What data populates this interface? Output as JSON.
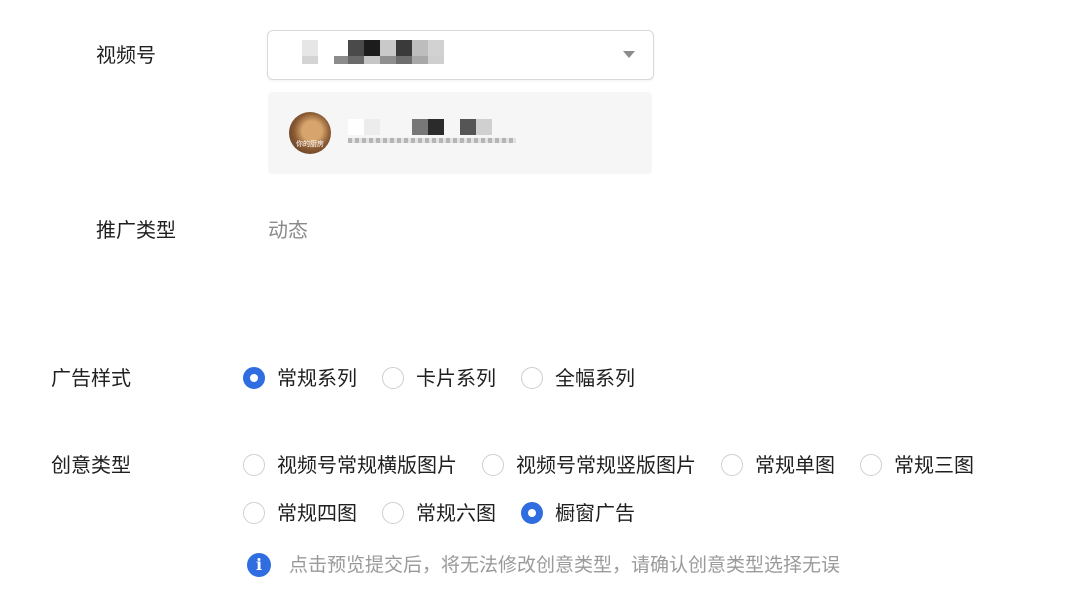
{
  "channel": {
    "label": "视频号",
    "select_icon": "chevron-down-icon",
    "account_avatar_caption": "你的厨房"
  },
  "promotion_type": {
    "label": "推广类型",
    "value": "动态"
  },
  "ad_style": {
    "label": "广告样式",
    "options": [
      {
        "label": "常规系列",
        "checked": true
      },
      {
        "label": "卡片系列",
        "checked": false
      },
      {
        "label": "全幅系列",
        "checked": false
      }
    ]
  },
  "creative_type": {
    "label": "创意类型",
    "options": [
      {
        "label": "视频号常规横版图片",
        "checked": false
      },
      {
        "label": "视频号常规竖版图片",
        "checked": false
      },
      {
        "label": "常规单图",
        "checked": false
      },
      {
        "label": "常规三图",
        "checked": false
      },
      {
        "label": "常规四图",
        "checked": false
      },
      {
        "label": "常规六图",
        "checked": false
      },
      {
        "label": "橱窗广告",
        "checked": true
      }
    ]
  },
  "notice": {
    "icon": "info-icon",
    "text": "点击预览提交后，将无法修改创意类型，请确认创意类型选择无误"
  },
  "colors": {
    "accent": "#2f6de1",
    "text": "#1f1f1f",
    "muted": "#8a8a8a",
    "card_bg": "#f6f6f6"
  }
}
